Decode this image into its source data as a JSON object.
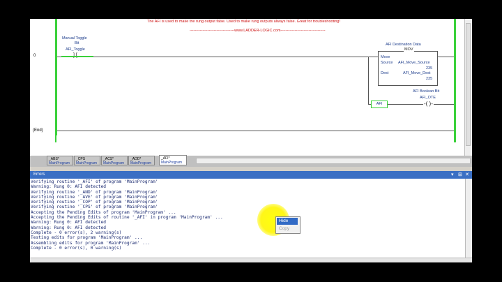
{
  "ladder": {
    "note_line1": "The AFI is used to make the rung output false. Used to make rung outputs always false. Great for troubleshooting!",
    "note_line2": "-----------------------------------www.LADDER-LOGIC.com-----------------------------------",
    "rung0_number": "0",
    "end_label": "(End)",
    "xic": {
      "title_line1": "Manual Toggle",
      "title_line2": "Bit",
      "tag": "AFI_Toggle",
      "symbol": "] [",
      "energized": true
    },
    "mov": {
      "title": "AFI Destination Data",
      "mnemonic": "MOV",
      "name": "Move",
      "source_label": "Source",
      "source_tag": "AFI_Move_Source",
      "source_value": "235",
      "dest_label": "Dest",
      "dest_tag": "AFI_Move_Dest",
      "dest_value": "235"
    },
    "ote": {
      "title": "AFI Boolean Bit",
      "tag": "AFI_OTE"
    },
    "afi_label": "AFI"
  },
  "routine_tabs": [
    {
      "name": "_ABS*",
      "program": "MainProgram"
    },
    {
      "name": "_CPS",
      "program": "MainProgram"
    },
    {
      "name": "_ACS*",
      "program": "MainProgram"
    },
    {
      "name": "_ADD*",
      "program": "MainProgram"
    },
    {
      "name": "_AFI*",
      "program": "MainProgram",
      "active": true
    }
  ],
  "errors_window": {
    "title": "Errors",
    "buttons": [
      "▾",
      "⊞",
      "✕"
    ],
    "log": [
      "Verifying routine '_AFI' of program 'MainProgram'",
      "Warning: Rung 0: AFI detected",
      "Verifying routine '_AND' of program 'MainProgram'",
      "Verifying routine '_AVE' of program 'MainProgram'",
      "Verifying routine '_COP' of program 'MainProgram'",
      "Verifying routine '_CPS' of program 'MainProgram'",
      "Accepting the Pending Edits of program 'MainProgram' ...",
      "Accepting the Pending Edits of routine '_AFI' in program 'MainProgram' ...",
      "Warning: Rung 0: AFI detected",
      "Warning: Rung 0: AFI detected",
      "Complete - 0 error(s), 2 warning(s)",
      "Testing edits for program 'MainProgram' ...",
      "Assembling edits for program 'MainProgram' ...",
      "Complete - 0 error(s), 0 warning(s)"
    ]
  },
  "context_menu": {
    "hide_label": "Hide",
    "copy_label": "Copy"
  },
  "colors": {
    "rail_green": "#3ad13a",
    "note_red": "#cc1111",
    "title_bar_blue": "#3a6fc4",
    "highlight_yellow": "#ffff00"
  }
}
